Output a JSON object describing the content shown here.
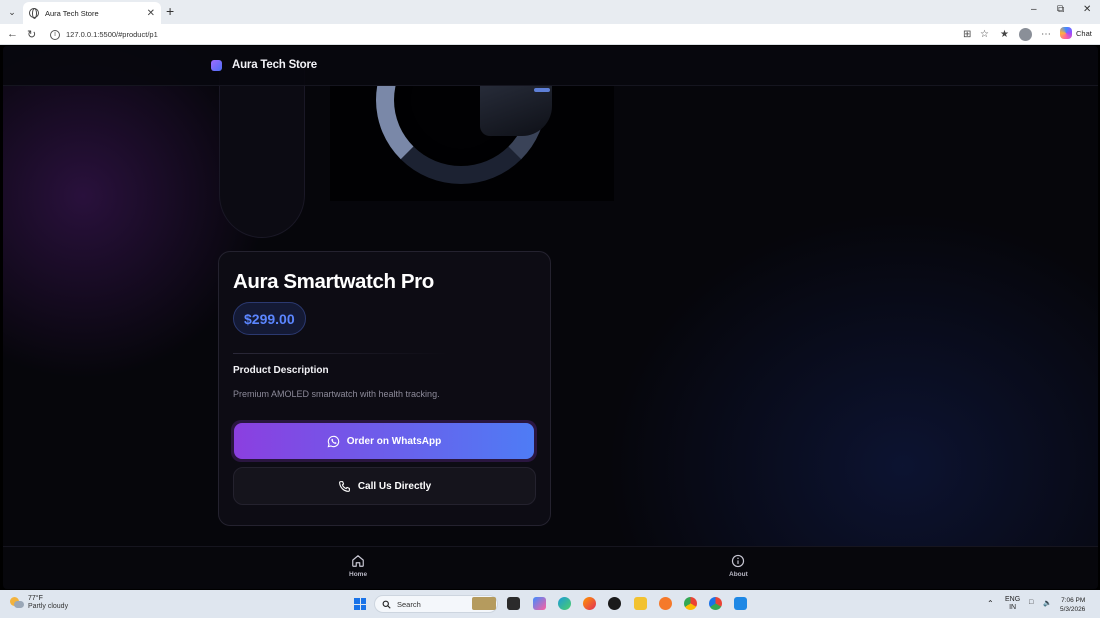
{
  "browser": {
    "tab_title": "Aura Tech Store",
    "url": "127.0.0.1:5500/#product/p1",
    "chat_label": "Chat"
  },
  "site": {
    "brand_name": "Aura Tech Store"
  },
  "product": {
    "title": "Aura Smartwatch Pro",
    "price": "$299.00",
    "description_heading": "Product Description",
    "description": "Premium AMOLED smartwatch with health tracking.",
    "order_button": "Order on WhatsApp",
    "call_button": "Call Us Directly"
  },
  "bottom_nav": {
    "home": "Home",
    "about": "About"
  },
  "taskbar": {
    "weather_temp": "77°F",
    "weather_condition": "Partly cloudy",
    "search_placeholder": "Search",
    "lang_line1": "ENG",
    "lang_line2": "IN",
    "time": "7:06 PM",
    "date": "5/3/2026"
  },
  "colors": {
    "accent_purple": "#8b3fe0",
    "accent_blue": "#4e7cf5",
    "price_blue": "#5b86ff"
  }
}
